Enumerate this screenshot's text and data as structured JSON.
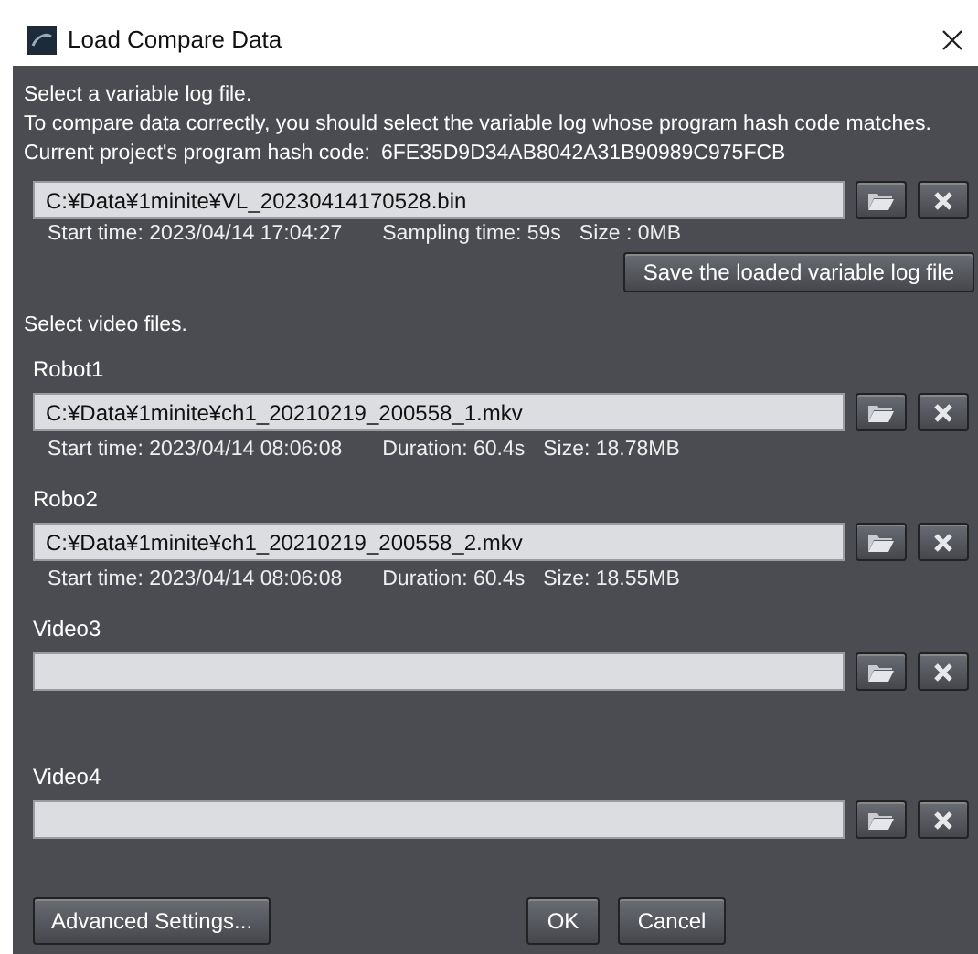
{
  "window": {
    "title": "Load Compare Data"
  },
  "instructions": [
    "Select a variable log file.",
    "To compare data correctly, you should select the variable log whose program hash code matches."
  ],
  "hash": {
    "label": "Current project's program hash code:",
    "value": "6FE35D9D34AB8042A31B90989C975FCB"
  },
  "log_file": {
    "path": "C:¥Data¥1minite¥VL_20230414170528.bin",
    "info": [
      "Start time: 2023/04/14 17:04:27",
      "Sampling time: 59s",
      "Size : 0MB"
    ]
  },
  "save_button": "Save the loaded variable log file",
  "video_heading": "Select video files.",
  "videos": [
    {
      "label": "Robot1",
      "path": "C:¥Data¥1minite¥ch1_20210219_200558_1.mkv",
      "info": [
        "Start time: 2023/04/14 08:06:08",
        "Duration: 60.4s",
        "Size: 18.78MB"
      ]
    },
    {
      "label": "Robo2",
      "path": "C:¥Data¥1minite¥ch1_20210219_200558_2.mkv",
      "info": [
        "Start time: 2023/04/14 08:06:08",
        "Duration: 60.4s",
        "Size: 18.55MB"
      ]
    },
    {
      "label": "Video3"
    },
    {
      "label": "Video4"
    }
  ],
  "buttons": {
    "advanced": "Advanced Settings...",
    "ok": "OK",
    "cancel": "Cancel"
  }
}
